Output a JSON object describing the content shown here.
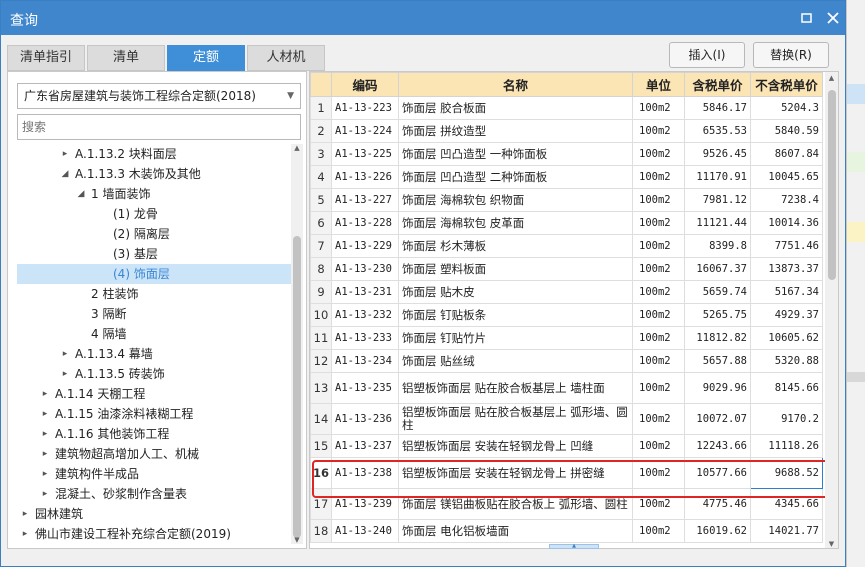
{
  "window": {
    "title": "查询",
    "tabs": [
      "清单指引",
      "清单",
      "定额",
      "人材机"
    ],
    "active_tab": "定额",
    "insert_button": "插入(I)",
    "replace_button": "替换(R)"
  },
  "left": {
    "selected_norm": "广东省房屋建筑与装饰工程综合定额(2018)",
    "search_placeholder": "搜索",
    "tree": [
      {
        "label": "A.1.13.2 块料面层",
        "arrow": "▸"
      },
      {
        "label": "A.1.13.3 木装饰及其他",
        "arrow": "◢"
      },
      {
        "label": "1 墙面装饰",
        "arrow": "◢"
      },
      {
        "label": "(1) 龙骨",
        "arrow": ""
      },
      {
        "label": "(2) 隔离层",
        "arrow": ""
      },
      {
        "label": "(3) 基层",
        "arrow": ""
      },
      {
        "label": "(4) 饰面层",
        "arrow": ""
      },
      {
        "label": "2 柱装饰",
        "arrow": ""
      },
      {
        "label": "3 隔断",
        "arrow": ""
      },
      {
        "label": "4 隔墙",
        "arrow": ""
      },
      {
        "label": "A.1.13.4 幕墙",
        "arrow": "▸"
      },
      {
        "label": "A.1.13.5 砖装饰",
        "arrow": "▸"
      },
      {
        "label": "A.1.14 天棚工程",
        "arrow": "▸"
      },
      {
        "label": "A.1.15 油漆涂料裱糊工程",
        "arrow": "▸"
      },
      {
        "label": "A.1.16 其他装饰工程",
        "arrow": "▸"
      },
      {
        "label": "建筑物超高增加人工、机械",
        "arrow": "▸"
      },
      {
        "label": "建筑构件半成品",
        "arrow": "▸"
      },
      {
        "label": "混凝土、砂浆制作含量表",
        "arrow": "▸"
      },
      {
        "label": "园林建筑",
        "arrow": "▸"
      },
      {
        "label": "佛山市建设工程补充综合定额(2019)",
        "arrow": "▸"
      }
    ]
  },
  "table": {
    "headers": [
      "",
      "编码",
      "名称",
      "单位",
      "含税单价",
      "不含税单价"
    ],
    "rows": [
      {
        "n": "1",
        "code": "A1-13-223",
        "name": "饰面层 胶合板面",
        "unit": "100m2",
        "tax": "5846.17",
        "notax": "5204.3"
      },
      {
        "n": "2",
        "code": "A1-13-224",
        "name": "饰面层 拼纹造型",
        "unit": "100m2",
        "tax": "6535.53",
        "notax": "5840.59"
      },
      {
        "n": "3",
        "code": "A1-13-225",
        "name": "饰面层 凹凸造型 一种饰面板",
        "unit": "100m2",
        "tax": "9526.45",
        "notax": "8607.84"
      },
      {
        "n": "4",
        "code": "A1-13-226",
        "name": "饰面层 凹凸造型 二种饰面板",
        "unit": "100m2",
        "tax": "11170.91",
        "notax": "10045.65"
      },
      {
        "n": "5",
        "code": "A1-13-227",
        "name": "饰面层 海棉软包 织物面",
        "unit": "100m2",
        "tax": "7981.12",
        "notax": "7238.4"
      },
      {
        "n": "6",
        "code": "A1-13-228",
        "name": "饰面层 海棉软包 皮革面",
        "unit": "100m2",
        "tax": "11121.44",
        "notax": "10014.36"
      },
      {
        "n": "7",
        "code": "A1-13-229",
        "name": "饰面层 杉木薄板",
        "unit": "100m2",
        "tax": "8399.8",
        "notax": "7751.46"
      },
      {
        "n": "8",
        "code": "A1-13-230",
        "name": "饰面层 塑料板面",
        "unit": "100m2",
        "tax": "16067.37",
        "notax": "13873.37"
      },
      {
        "n": "9",
        "code": "A1-13-231",
        "name": "饰面层 贴木皮",
        "unit": "100m2",
        "tax": "5659.74",
        "notax": "5167.34"
      },
      {
        "n": "10",
        "code": "A1-13-232",
        "name": "饰面层 钉贴板条",
        "unit": "100m2",
        "tax": "5265.75",
        "notax": "4929.37"
      },
      {
        "n": "11",
        "code": "A1-13-233",
        "name": "饰面层 钉贴竹片",
        "unit": "100m2",
        "tax": "11812.82",
        "notax": "10605.62"
      },
      {
        "n": "12",
        "code": "A1-13-234",
        "name": "饰面层 贴丝绒",
        "unit": "100m2",
        "tax": "5657.88",
        "notax": "5320.88"
      },
      {
        "n": "13",
        "code": "A1-13-235",
        "name": "铝塑板饰面层 贴在胶合板基层上 墙柱面",
        "unit": "100m2",
        "tax": "9029.96",
        "notax": "8145.66"
      },
      {
        "n": "14",
        "code": "A1-13-236",
        "name": "铝塑板饰面层 贴在胶合板基层上 弧形墙、圆柱",
        "unit": "100m2",
        "tax": "10072.07",
        "notax": "9170.2"
      },
      {
        "n": "15",
        "code": "A1-13-237",
        "name": "铝塑板饰面层 安装在轻钢龙骨上 凹缝",
        "unit": "100m2",
        "tax": "12243.66",
        "notax": "11118.26"
      },
      {
        "n": "16",
        "code": "A1-13-238",
        "name": "铝塑板饰面层 安装在轻钢龙骨上 拼密缝",
        "unit": "100m2",
        "tax": "10577.66",
        "notax": "9688.52"
      },
      {
        "n": "17",
        "code": "A1-13-239",
        "name": "饰面层 镁铝曲板贴在胶合板上 弧形墙、圆柱",
        "unit": "100m2",
        "tax": "4775.46",
        "notax": "4345.66"
      },
      {
        "n": "18",
        "code": "A1-13-240",
        "name": "饰面层 电化铝板墙面",
        "unit": "100m2",
        "tax": "16019.62",
        "notax": "14021.77"
      }
    ]
  },
  "colors": {
    "titlebar": "#3f86cc",
    "active_tab": "#3f8fd8",
    "header_bg": "#fbe5b5",
    "selection_outline": "#e02525",
    "tree_selected": "#cce4f7"
  }
}
